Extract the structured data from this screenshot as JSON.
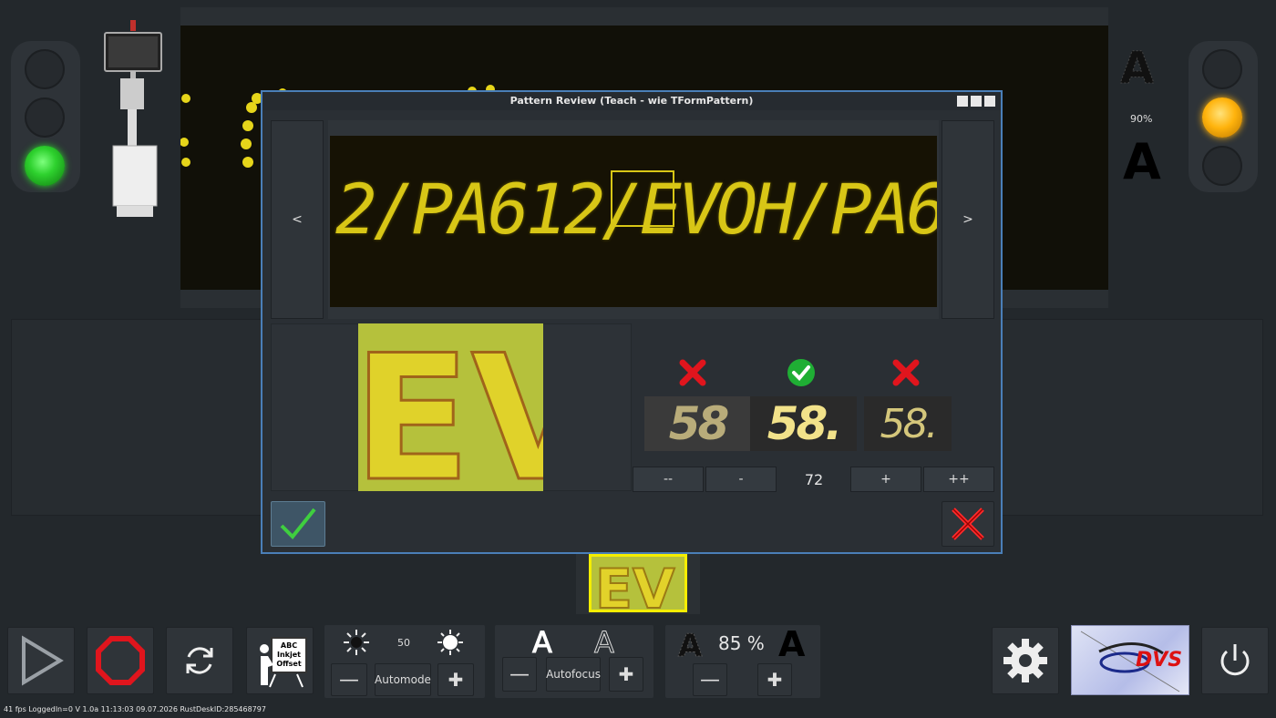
{
  "dialog": {
    "title": "Pattern Review (Teach - wie TFormPattern)",
    "prev_label": "<",
    "next_label": ">",
    "ocr_text": "2/PA612/EVOH/PA6<",
    "crop_text": "EV",
    "matches": [
      {
        "status": "rejected",
        "text": "58"
      },
      {
        "status": "accepted",
        "text": "58."
      },
      {
        "status": "rejected",
        "text": "58."
      }
    ],
    "steps": {
      "dec_big": "--",
      "dec": "-",
      "value": "72",
      "inc": "+",
      "inc_big": "++"
    }
  },
  "right_panel": {
    "contrast_pct": "90%"
  },
  "toolbar": {
    "brightness_value": "50",
    "automode_label": "Automode",
    "autofocus_label": "Autofocus",
    "contrast_value": "85 %",
    "teach_icon_text": [
      "ABC",
      "Inkjet",
      "Offset"
    ],
    "logo_text": "DVS"
  },
  "status_bar": "41 fps LoggedIn=0 V 1.0a 11:13:03 09.07.2026 RustDeskID:285468797",
  "colors": {
    "background": "#23282c",
    "dialog_border": "#4a7fb8",
    "ocr_yellow": "#d8c616",
    "green_lamp": "#2ed12e",
    "amber_lamp": "#ffb30c",
    "stop_red": "#e0151d"
  }
}
